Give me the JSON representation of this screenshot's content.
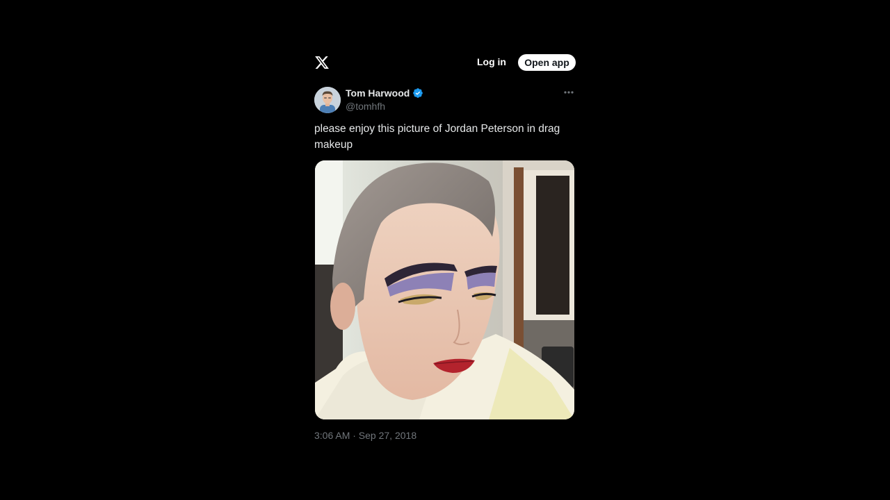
{
  "header": {
    "logo_icon": "x-logo-icon",
    "login_label": "Log in",
    "open_app_label": "Open app"
  },
  "tweet": {
    "author": {
      "display_name": "Tom Harwood",
      "handle": "@tomhfh",
      "verified": true,
      "verified_color": "#1d9bf0"
    },
    "more_icon": "more-horizontal-icon",
    "text": "please enjoy this picture of Jordan Peterson in drag makeup",
    "media_icon": "photo",
    "timestamp": "3:06 AM · Sep 27, 2018"
  },
  "colors": {
    "background": "#000000",
    "primary_text": "#e7e9ea",
    "secondary_text": "#71767b",
    "button_bg": "#ffffff",
    "accent": "#1d9bf0"
  }
}
